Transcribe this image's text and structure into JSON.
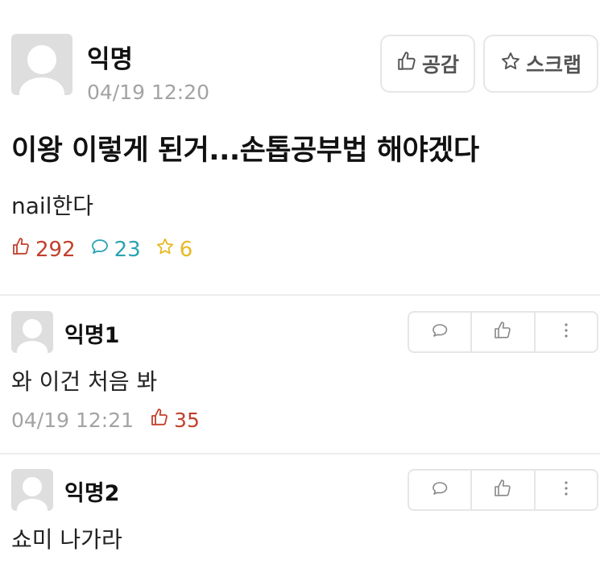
{
  "post": {
    "author": "익명",
    "time": "04/19 12:20",
    "buttons": {
      "like_label": "공감",
      "scrap_label": "스크랩"
    },
    "title": "이왕 이렇게 된거...손톱공부법 해야겠다",
    "body": "nail한다",
    "stats": {
      "likes": "292",
      "comments": "23",
      "scraps": "6"
    }
  },
  "comments": [
    {
      "author": "익명1",
      "text": "와 이건 처음 봐",
      "time": "04/19 12:21",
      "likes": "35"
    },
    {
      "author": "익명2",
      "text": "쇼미 나가라"
    }
  ],
  "colors": {
    "like": "#c2402c",
    "comment": "#2aa3b3",
    "scrap": "#e8b923",
    "muted": "#a3a3a3"
  },
  "icons": [
    "thumbs-up-icon",
    "star-icon",
    "speech-bubble-icon",
    "more-vertical-icon"
  ]
}
